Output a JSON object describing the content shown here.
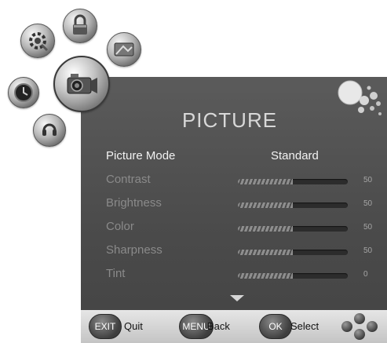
{
  "menu": {
    "title": "PICTURE",
    "items": [
      {
        "label": "Picture Mode",
        "value": "Standard",
        "active": true
      },
      {
        "label": "Contrast",
        "number": "50",
        "level": 0.5
      },
      {
        "label": "Brightness",
        "number": "50",
        "level": 0.5
      },
      {
        "label": "Color",
        "number": "50",
        "level": 0.5
      },
      {
        "label": "Sharpness",
        "number": "50",
        "level": 0.5
      },
      {
        "label": "Tint",
        "number": "0",
        "level": 0.5
      }
    ],
    "more_indicator_icon": "arrow-down-icon"
  },
  "help_bar": {
    "exit_key": "EXIT",
    "exit_label": "Quit",
    "menu_key": "MENU",
    "menu_label": "Back",
    "ok_key": "OK",
    "ok_label": "Select",
    "nav_icon": "dpad-icon"
  },
  "icon_wheel": [
    {
      "name": "setup-icon"
    },
    {
      "name": "lock-icon"
    },
    {
      "name": "tv-channel-icon"
    },
    {
      "name": "picture-camera-icon",
      "selected": true
    },
    {
      "name": "clock-icon"
    },
    {
      "name": "sound-icon"
    }
  ],
  "colors": {
    "panel": "#4e4e4e",
    "help_bar": "#d4d4d4",
    "active_text": "#f2f2f2",
    "inactive_text": "#8a8a8a"
  }
}
